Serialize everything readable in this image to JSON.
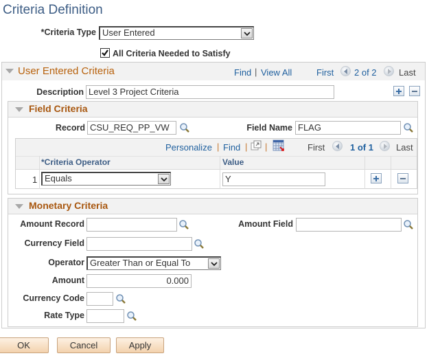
{
  "page": {
    "title": "Criteria Definition",
    "criteria_type_label": "*Criteria Type",
    "criteria_type_value": "User Entered",
    "all_criteria_label": "All Criteria Needed to Satisfy",
    "all_criteria_checked": true
  },
  "user_entered": {
    "header": "User Entered Criteria",
    "find": "Find",
    "separator": "|",
    "view_all": "View All",
    "first": "First",
    "counter": "2 of 2",
    "last": "Last",
    "description_label": "Description",
    "description_value": "Level 3 Project Criteria",
    "add_icon": "plus-icon",
    "delete_icon": "minus-icon"
  },
  "field_criteria": {
    "header": "Field Criteria",
    "record_label": "Record",
    "record_value": "CSU_REQ_PP_VW",
    "field_name_label": "Field Name",
    "field_name_value": "FLAG",
    "grid": {
      "personalize": "Personalize",
      "separator": "|",
      "find": "Find",
      "zoom_icon": "new-window-icon",
      "download_icon": "download-grid-icon",
      "first": "First",
      "counter": "1 of 1",
      "last": "Last",
      "columns": [
        "*Criteria Operator",
        "Value"
      ],
      "rows": [
        {
          "num": "1",
          "operator": "Equals",
          "value": "Y"
        }
      ]
    }
  },
  "monetary_criteria": {
    "header": "Monetary Criteria",
    "amount_record_label": "Amount Record",
    "amount_record_value": "",
    "amount_field_label": "Amount Field",
    "amount_field_value": "",
    "currency_field_label": "Currency Field",
    "currency_field_value": "",
    "operator_label": "Operator",
    "operator_value": "Greater Than or Equal To",
    "amount_label": "Amount",
    "amount_value": "0.000",
    "currency_code_label": "Currency Code",
    "currency_code_value": "",
    "rate_type_label": "Rate Type",
    "rate_type_value": ""
  },
  "buttons": {
    "ok": "OK",
    "cancel": "Cancel",
    "apply": "Apply"
  },
  "colors": {
    "title": "#3d5d85",
    "section_header": "#a8570f",
    "link": "#1e5f9e",
    "button_bg": "#f3d2ad"
  }
}
